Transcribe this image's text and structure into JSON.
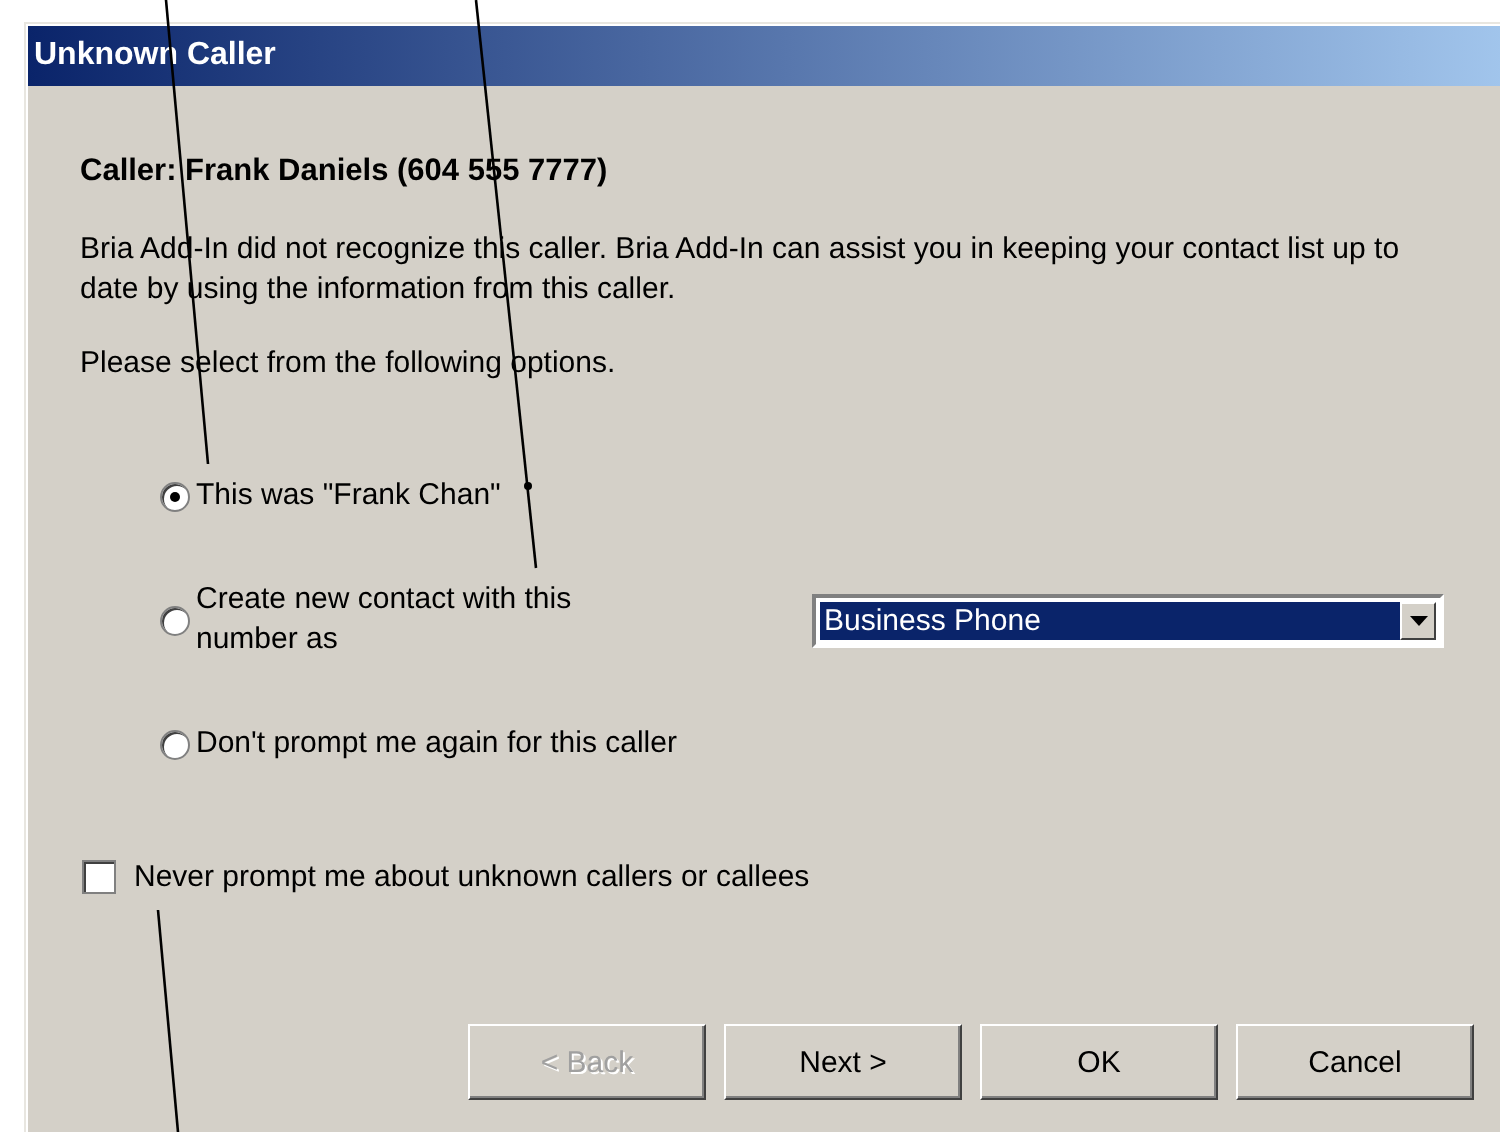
{
  "window": {
    "title": "Unknown Caller"
  },
  "caller": "Caller: Frank Daniels (604 555 7777)",
  "message": "Bria Add-In did not recognize this caller. Bria Add-In can assist you in keeping your contact list up to date by using the information from this caller.",
  "instruction": "Please select from the following options.",
  "options": [
    {
      "label": "This was \"Frank Chan\"",
      "selected": true
    },
    {
      "label": "Create new contact with this number as",
      "selected": false,
      "dropdown": {
        "value": "Business Phone"
      }
    },
    {
      "label": "Don't prompt me again for this caller",
      "selected": false
    }
  ],
  "never_prompt": {
    "label": "Never prompt me about unknown callers or callees",
    "checked": false
  },
  "buttons": [
    {
      "label": "< Back",
      "disabled": true
    },
    {
      "label": "Next >",
      "disabled": false
    },
    {
      "label": "OK",
      "disabled": false
    },
    {
      "label": "Cancel",
      "disabled": false
    }
  ]
}
